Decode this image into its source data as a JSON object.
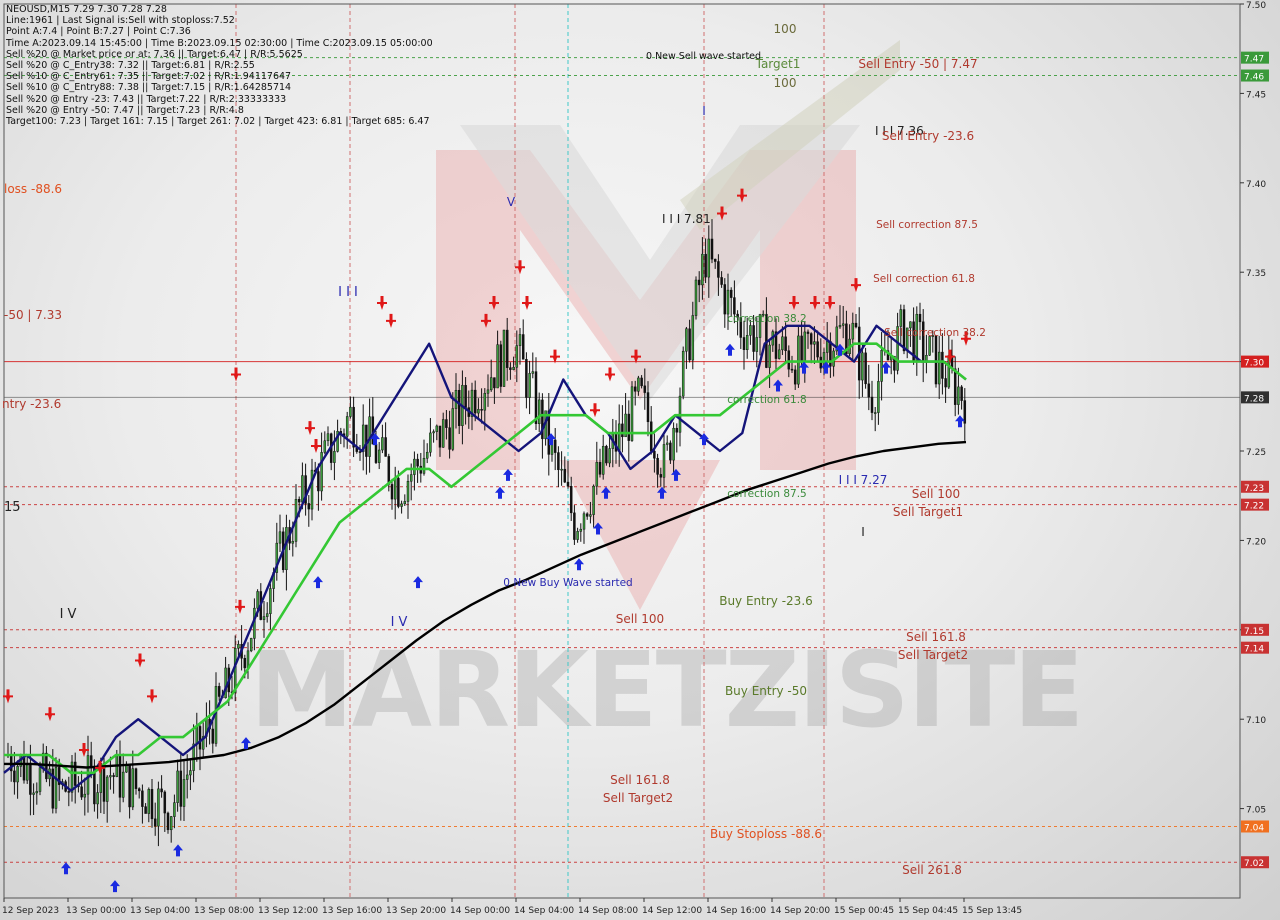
{
  "header": {
    "lines": [
      "NEOUSD,M15  7.29 7.30 7.28 7.28",
      "Line:1961 | Last Signal is:Sell with stoploss:7.52",
      "Point A:7.4 | Point B:7.27 | Point C:7.36",
      "Time A:2023.09.14 15:45:00 | Time B:2023.09.15 02:30:00 | Time C:2023.09.15 05:00:00",
      "Sell %20 @ Market price or at: 7.36 || Target:6.47 | R/R:5.5625",
      "Sell %20 @ C_Entry38: 7.32 || Target:6.81 | R/R:2.55",
      "Sell %10 @ C_Entry61: 7.35 || Target:7.02 | R/R:1.94117647",
      "Sell %10 @ C_Entry88: 7.38 || Target:7.15 | R/R:1.64285714",
      "Sell %20 @ Entry -23: 7.43 || Target:7.22 | R/R:2.33333333",
      "Sell %20 @ Entry -50: 7.47 || Target:7.23 | R/R:4.8",
      "Target100: 7.23 | Target 161: 7.15 | Target 261: 7.02 | Target 423: 6.81 | Target 685: 6.47"
    ]
  },
  "watermark": "MARKETZISITE",
  "chart_data": {
    "type": "candlestick",
    "symbol": "NEOUSD",
    "timeframe": "M15",
    "ylim": [
      7.0,
      7.5
    ],
    "y_ticks": [
      "7.50",
      "7.45",
      "7.40",
      "7.35",
      "7.30",
      "7.25",
      "7.20",
      "7.15",
      "7.10",
      "7.05"
    ],
    "x_ticks": [
      "12 Sep 2023",
      "13 Sep 00:00",
      "13 Sep 04:00",
      "13 Sep 08:00",
      "13 Sep 12:00",
      "13 Sep 16:00",
      "13 Sep 20:00",
      "14 Sep 00:00",
      "14 Sep 04:00",
      "14 Sep 08:00",
      "14 Sep 12:00",
      "14 Sep 16:00",
      "14 Sep 20:00",
      "15 Sep 00:45",
      "15 Sep 04:45",
      "15 Sep 13:45"
    ],
    "price_tags": [
      {
        "value": 7.47,
        "label": "7.47",
        "color": "#3a9a3a"
      },
      {
        "value": 7.46,
        "label": "7.46",
        "color": "#3a9a3a"
      },
      {
        "value": 7.3,
        "label": "7.30",
        "color": "#d42020"
      },
      {
        "value": 7.28,
        "label": "7.28",
        "color": "#303030"
      },
      {
        "value": 7.23,
        "label": "7.23",
        "color": "#c83232"
      },
      {
        "value": 7.22,
        "label": "7.22",
        "color": "#c83232"
      },
      {
        "value": 7.15,
        "label": "7.15",
        "color": "#c83232"
      },
      {
        "value": 7.14,
        "label": "7.14",
        "color": "#c83232"
      },
      {
        "value": 7.04,
        "label": "7.04",
        "color": "#f07020"
      },
      {
        "value": 7.02,
        "label": "7.02",
        "color": "#c83232"
      }
    ],
    "annotations": [
      {
        "text": "0 New Sell wave started",
        "color": "#111111"
      },
      {
        "text": "100",
        "color": "#6a6a3a"
      },
      {
        "text": "Target1",
        "color": "#5a8a3a"
      },
      {
        "text": "100",
        "color": "#6a6a3a"
      },
      {
        "text": "Sell Entry -50 | 7.47",
        "color": "#b03a2e"
      },
      {
        "text": "I I I 7.36",
        "color": "#222222"
      },
      {
        "text": "Sell Entry -23.6",
        "color": "#b03a2e"
      },
      {
        "text": "Sell correction 87.5",
        "color": "#b03a2e"
      },
      {
        "text": "Sell correction 61.8",
        "color": "#b03a2e"
      },
      {
        "text": "Sell correction 38.2",
        "color": "#b03a2e"
      },
      {
        "text": "I I I 7.81",
        "color": "#222222"
      },
      {
        "text": "I",
        "color": "#2a2ab0"
      },
      {
        "text": "V",
        "color": "#2a2ab0"
      },
      {
        "text": "I I I",
        "color": "#2a2ab0"
      },
      {
        "text": "loss -88.6",
        "color": "#e05020"
      },
      {
        "text": "-50 | 7.33",
        "color": "#b03a2e"
      },
      {
        "text": "ntry -23.6",
        "color": "#b03a2e"
      },
      {
        "text": "15",
        "color": "#222222"
      },
      {
        "text": "I V",
        "color": "#222222"
      },
      {
        "text": "I V",
        "color": "#2a2ab0"
      },
      {
        "text": "correction 61.8",
        "color": "#3a8a3a"
      },
      {
        "text": "correction 87.5",
        "color": "#3a8a3a"
      },
      {
        "text": "correction 38.2",
        "color": "#3a8a3a"
      },
      {
        "text": "I I I 7.27",
        "color": "#2a2ab0"
      },
      {
        "text": "Sell 100",
        "color": "#b03a2e"
      },
      {
        "text": "Sell Target1",
        "color": "#b03a2e"
      },
      {
        "text": "I",
        "color": "#222222"
      },
      {
        "text": "0 New Buy Wave started",
        "color": "#2a2ab0"
      },
      {
        "text": "Sell 100",
        "color": "#b03a2e"
      },
      {
        "text": "Buy Entry -23.6",
        "color": "#5a7a2a"
      },
      {
        "text": "Sell 161.8",
        "color": "#b03a2e"
      },
      {
        "text": "Sell Target2",
        "color": "#b03a2e"
      },
      {
        "text": "Buy Entry -50",
        "color": "#5a7a2a"
      },
      {
        "text": "Sell 161.8",
        "color": "#b03a2e"
      },
      {
        "text": "Sell Target2",
        "color": "#b03a2e"
      },
      {
        "text": "Buy Stoploss -88.6",
        "color": "#e05020"
      },
      {
        "text": "Sell  261.8",
        "color": "#b03a2e"
      }
    ],
    "series": [
      {
        "name": "",
        "color": "#14147a",
        "y": [
          7.07,
          7.08,
          7.07,
          7.06,
          7.07,
          7.09,
          7.1,
          7.09,
          7.08,
          7.09,
          7.12,
          7.15,
          7.18,
          7.21,
          7.24,
          7.26,
          7.25,
          7.27,
          7.29,
          7.31,
          7.28,
          7.27,
          7.26,
          7.25,
          7.26,
          7.29,
          7.27,
          7.26,
          7.24,
          7.25,
          7.27,
          7.26,
          7.25,
          7.26,
          7.31,
          7.32,
          7.32,
          7.31,
          7.3,
          7.32,
          7.31,
          7.3,
          7.3,
          7.29
        ]
      },
      {
        "name": "",
        "color": "#34c834",
        "y": [
          7.08,
          7.08,
          7.08,
          7.07,
          7.07,
          7.08,
          7.08,
          7.09,
          7.09,
          7.1,
          7.11,
          7.13,
          7.15,
          7.17,
          7.19,
          7.21,
          7.22,
          7.23,
          7.24,
          7.24,
          7.23,
          7.24,
          7.25,
          7.26,
          7.27,
          7.27,
          7.27,
          7.26,
          7.26,
          7.26,
          7.27,
          7.27,
          7.27,
          7.28,
          7.29,
          7.3,
          7.3,
          7.3,
          7.31,
          7.31,
          7.3,
          7.3,
          7.3,
          7.29
        ]
      },
      {
        "name": "",
        "color": "#000000",
        "y": [
          7.075,
          7.075,
          7.074,
          7.073,
          7.074,
          7.075,
          7.076,
          7.078,
          7.08,
          7.084,
          7.09,
          7.098,
          7.108,
          7.12,
          7.132,
          7.144,
          7.155,
          7.164,
          7.172,
          7.178,
          7.185,
          7.192,
          7.198,
          7.204,
          7.21,
          7.216,
          7.222,
          7.228,
          7.233,
          7.238,
          7.243,
          7.247,
          7.25,
          7.252,
          7.254,
          7.255
        ]
      }
    ]
  }
}
